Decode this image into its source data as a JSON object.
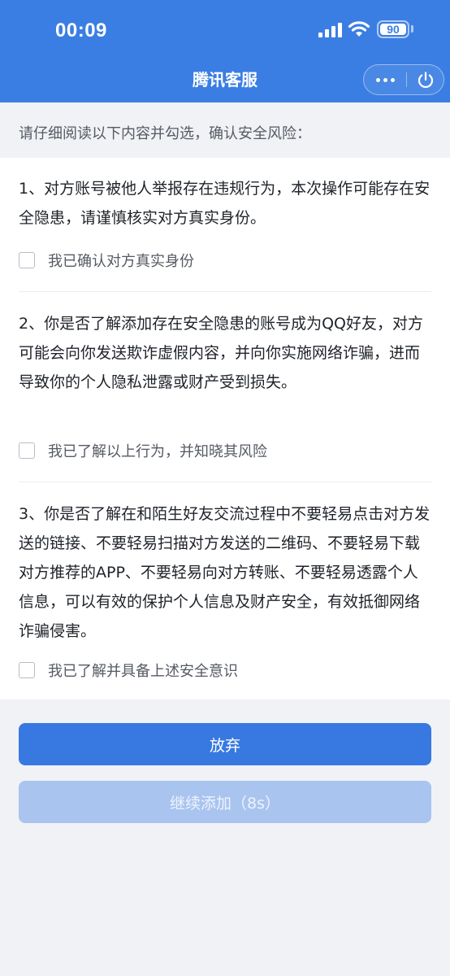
{
  "status_bar": {
    "time": "00:09",
    "battery": "90"
  },
  "nav": {
    "title": "腾讯客服"
  },
  "intro": "请仔细阅读以下内容并勾选，确认安全风险：",
  "items": [
    {
      "question": "1、对方账号被他人举报存在违规行为，本次操作可能存在安全隐患，请谨慎核实对方真实身份。",
      "checkbox_label": "我已确认对方真实身份",
      "checked": false
    },
    {
      "question": "2、你是否了解添加存在安全隐患的账号成为QQ好友，对方可能会向你发送欺诈虚假内容，并向你实施网络诈骗，进而导致你的个人隐私泄露或财产受到损失。",
      "checkbox_label": "我已了解以上行为，并知晓其风险",
      "checked": false
    },
    {
      "question": "3、你是否了解在和陌生好友交流过程中不要轻易点击对方发送的链接、不要轻易扫描对方发送的二维码、不要轻易下载对方推荐的APP、不要轻易向对方转账、不要轻易透露个人信息，可以有效的保护个人信息及财产安全，有效抵御网络诈骗侵害。",
      "checkbox_label": "我已了解并具备上述安全意识",
      "checked": false
    }
  ],
  "buttons": {
    "abandon": "放弃",
    "continue": "继续添加（8s）"
  },
  "colors": {
    "header": "#3b7ee3",
    "primary_button": "#3779e0",
    "disabled_button": "#a9c4ef",
    "page_background": "#f1f2f6"
  },
  "icons": [
    "cellular-signal-icon",
    "wifi-icon",
    "battery-icon",
    "more-icon",
    "close-miniprogram-icon"
  ]
}
